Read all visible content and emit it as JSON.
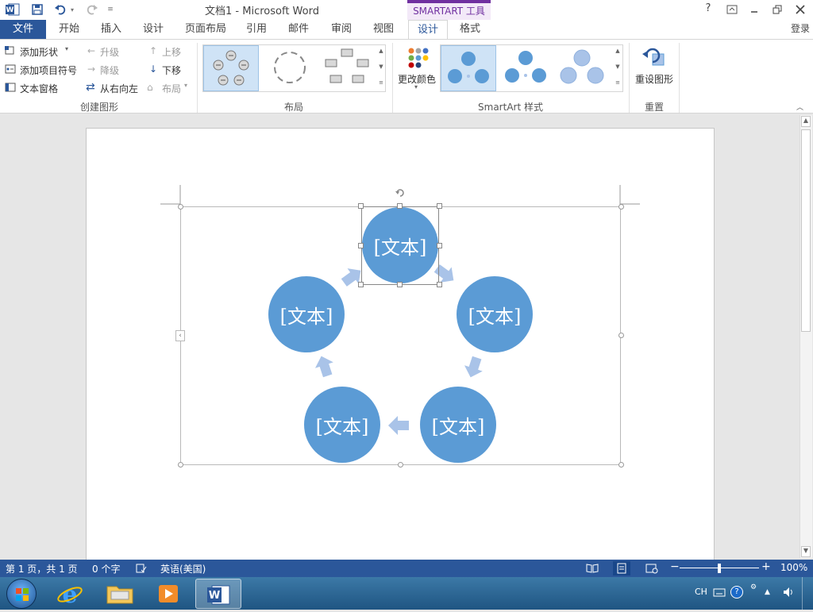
{
  "window": {
    "title": "文档1 - Microsoft Word",
    "contextual_group": "SMARTART 工具",
    "help_label": "?",
    "signin": "登录"
  },
  "tabs": [
    {
      "label": "文件"
    },
    {
      "label": "开始"
    },
    {
      "label": "插入"
    },
    {
      "label": "设计"
    },
    {
      "label": "页面布局"
    },
    {
      "label": "引用"
    },
    {
      "label": "邮件"
    },
    {
      "label": "审阅"
    },
    {
      "label": "视图"
    },
    {
      "label": "设计"
    },
    {
      "label": "格式"
    }
  ],
  "ribbon": {
    "create": {
      "add_shape": "添加形状",
      "add_bullet": "添加项目符号",
      "text_pane": "文本窗格",
      "promote": "升级",
      "demote": "降级",
      "right_to_left": "从右向左",
      "move_up": "上移",
      "move_down": "下移",
      "layout": "布局",
      "group_label": "创建图形"
    },
    "layouts": {
      "group_label": "布局"
    },
    "styles": {
      "change_colors": "更改颜色",
      "group_label": "SmartArt 样式"
    },
    "reset": {
      "reset_graphic": "重设图形",
      "group_label": "重置"
    }
  },
  "diagram": {
    "nodes": [
      {
        "text": "[文本]"
      },
      {
        "text": "[文本]"
      },
      {
        "text": "[文本]"
      },
      {
        "text": "[文本]"
      },
      {
        "text": "[文本]"
      }
    ]
  },
  "status": {
    "page": "第 1 页，共 1 页",
    "words": "0 个字",
    "language": "英语(美国)",
    "zoom": "100%",
    "zoom_level_percent": 100
  },
  "tray": {
    "ime": "CH"
  },
  "colors": {
    "accent": "#2b579a",
    "smartart_contextual": "#7030a0",
    "node_fill": "#5b9bd5",
    "arrow_fill": "#a9c3e8"
  }
}
